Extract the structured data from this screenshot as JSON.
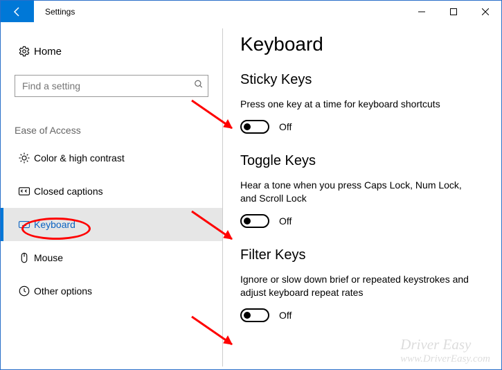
{
  "window": {
    "title": "Settings"
  },
  "sidebar": {
    "home": "Home",
    "search_placeholder": "Find a setting",
    "group": "Ease of Access",
    "items": [
      {
        "label": "Color & high contrast"
      },
      {
        "label": "Closed captions"
      },
      {
        "label": "Keyboard"
      },
      {
        "label": "Mouse"
      },
      {
        "label": "Other options"
      }
    ]
  },
  "content": {
    "page_title": "Keyboard",
    "sections": [
      {
        "title": "Sticky Keys",
        "text": "Press one key at a time for keyboard shortcuts",
        "toggle_state": "Off"
      },
      {
        "title": "Toggle Keys",
        "text": "Hear a tone when you press Caps Lock, Num Lock, and Scroll Lock",
        "toggle_state": "Off"
      },
      {
        "title": "Filter Keys",
        "text": "Ignore or slow down brief or repeated keystrokes and adjust keyboard repeat rates",
        "toggle_state": "Off"
      }
    ]
  },
  "watermark": {
    "line1": "Driver Easy",
    "line2": "www.DriverEasy.com"
  }
}
